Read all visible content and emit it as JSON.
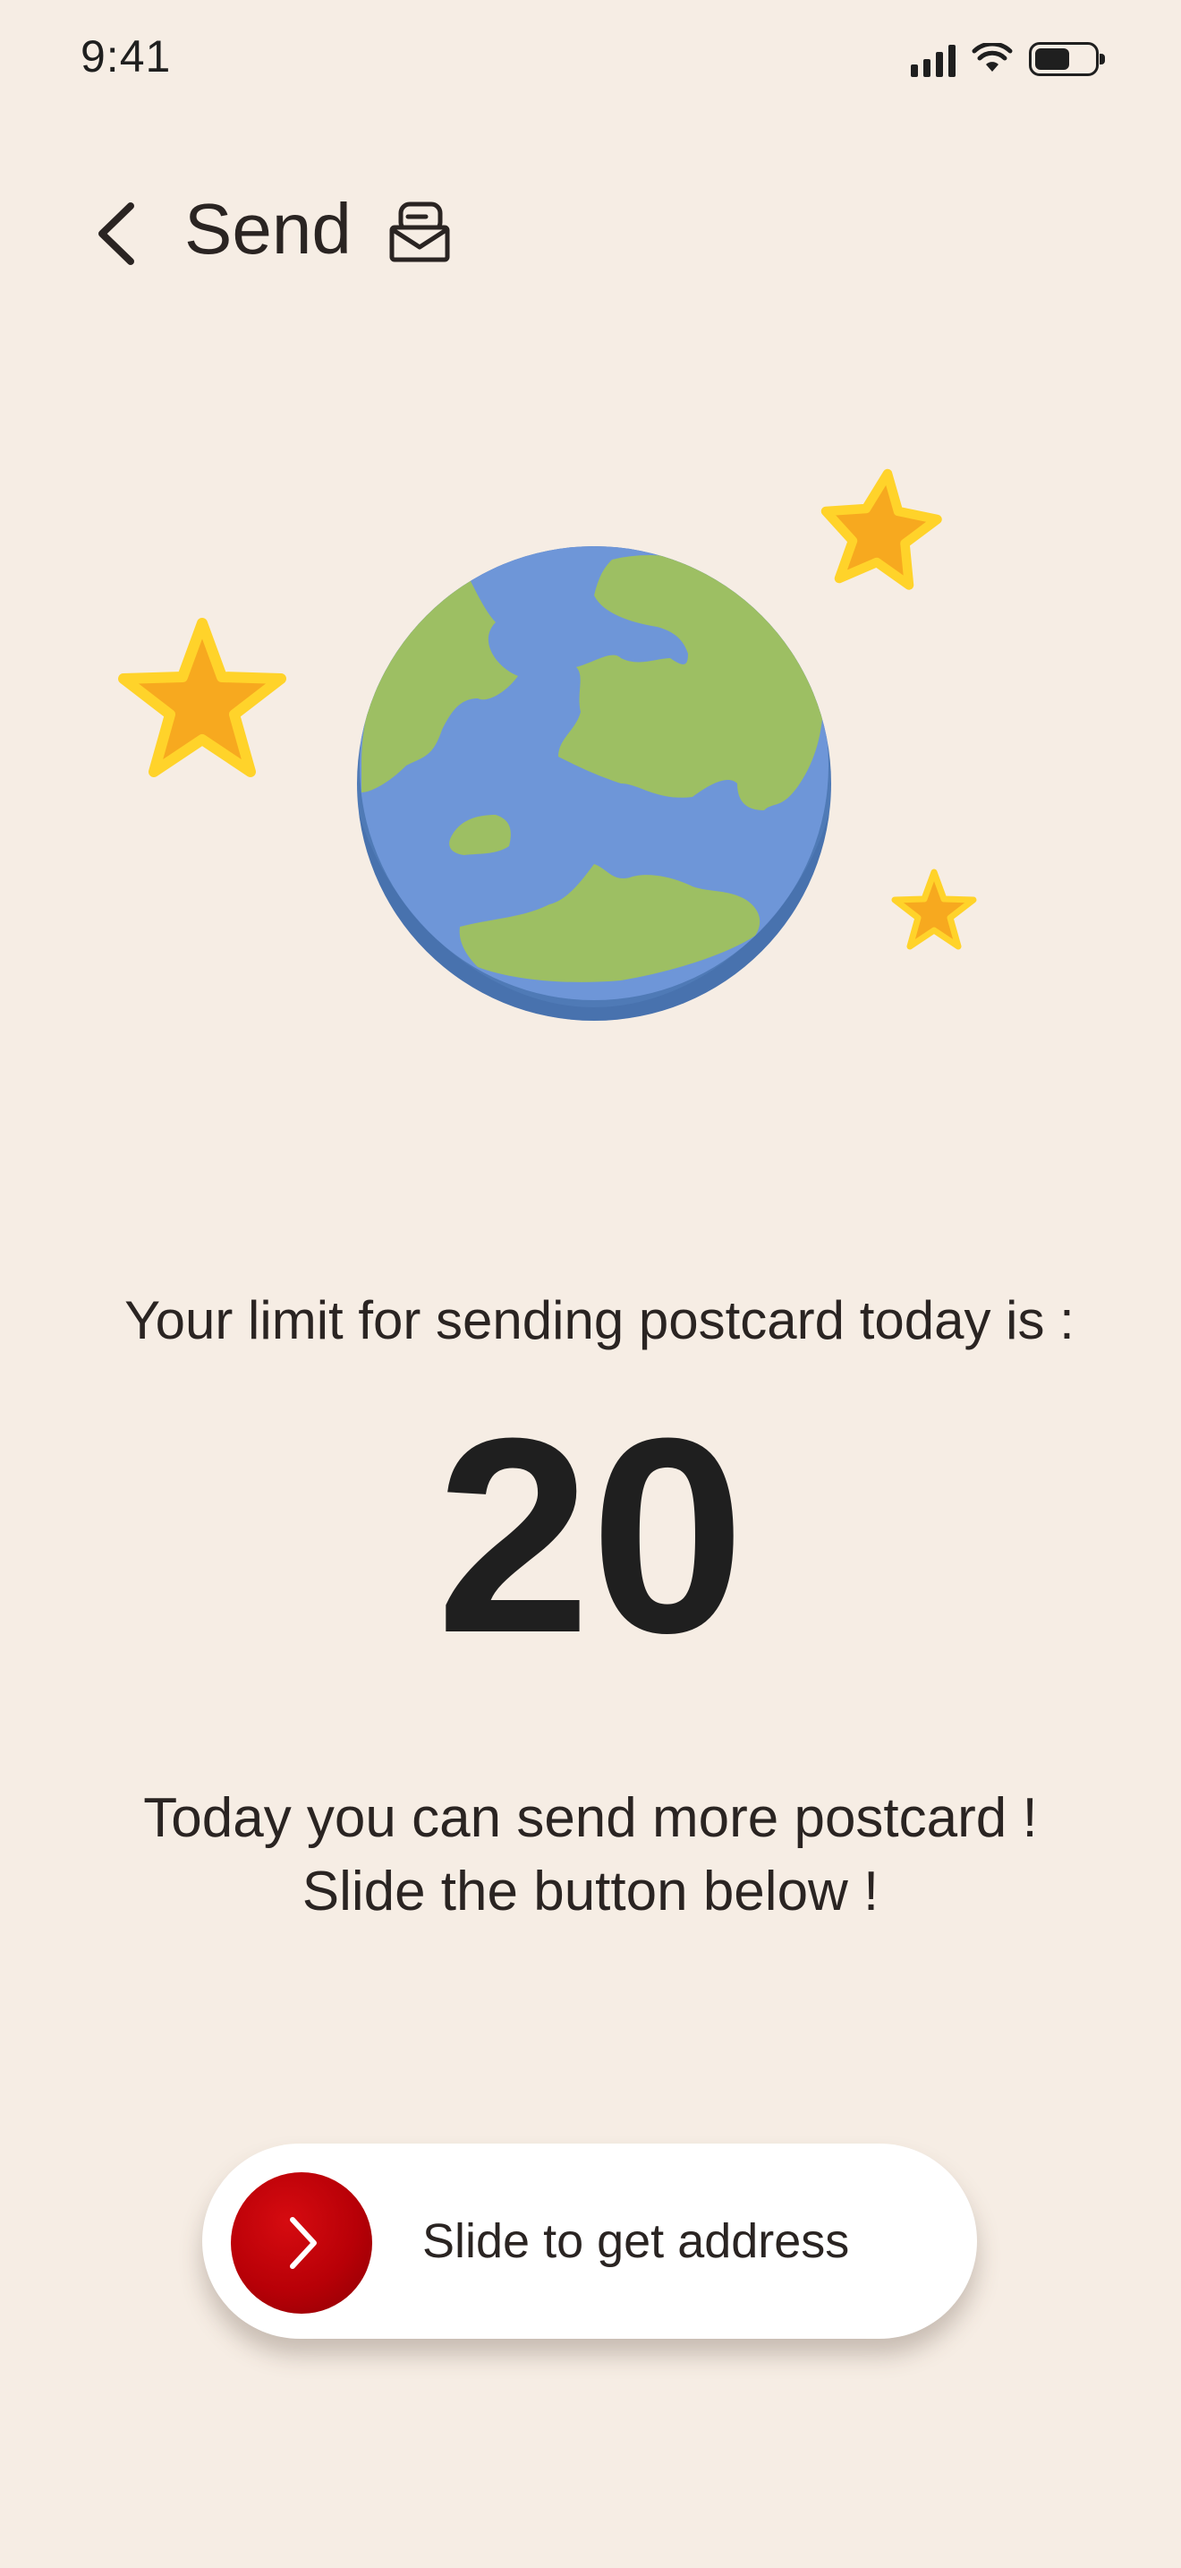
{
  "status_bar": {
    "time": "9:41",
    "battery_level": 0.6
  },
  "header": {
    "title": "Send",
    "back_icon": "chevron-left-icon",
    "title_icon": "mailbox-icon"
  },
  "illustration": {
    "items": [
      "earth-globe",
      "star",
      "star",
      "star"
    ]
  },
  "limit": {
    "label": "Your limit for sending postcard today is :",
    "value": "20"
  },
  "message": {
    "line1": "Today you can send more postcard !",
    "line2": "Slide the button below !"
  },
  "slider": {
    "label": "Slide to get address",
    "knob_icon": "chevron-right-icon",
    "knob_color": "#b80007"
  },
  "colors": {
    "background": "#f6ede4",
    "accent": "#b80007",
    "ocean": "#6e96d8",
    "land": "#9dbf63",
    "star": "#f7a91f"
  }
}
